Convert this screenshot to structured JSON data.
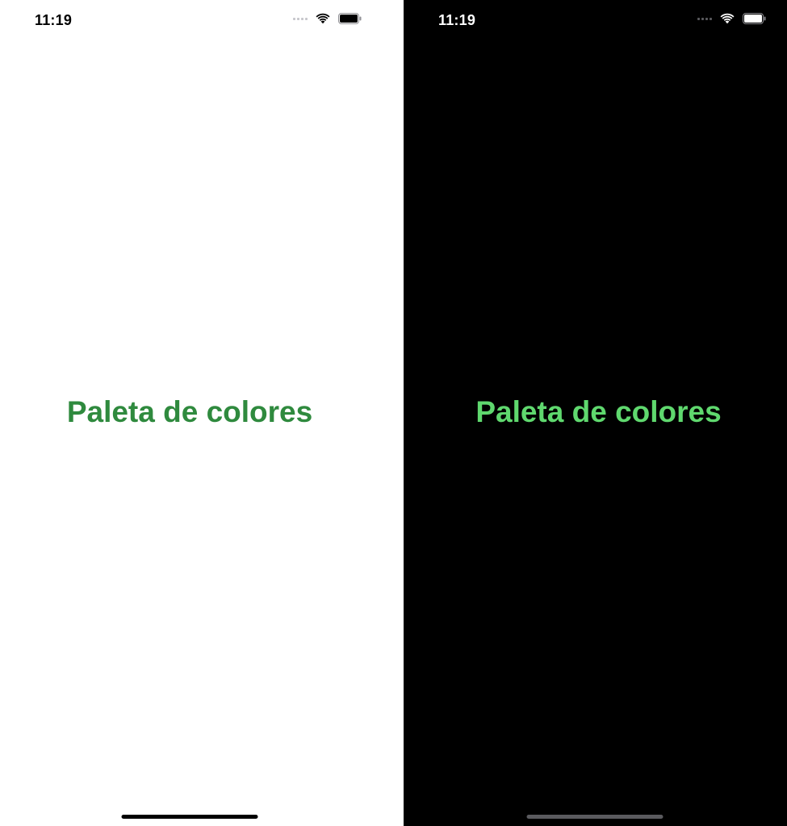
{
  "screens": [
    {
      "theme": "light",
      "time": "11:19",
      "headline": "Paleta de colores",
      "colors": {
        "background": "#ffffff",
        "headline": "#2f8a3e",
        "home_indicator": "#000000"
      },
      "icons": [
        "signal-icon",
        "wifi-icon",
        "battery-icon"
      ]
    },
    {
      "theme": "dark",
      "time": "11:19",
      "headline": "Paleta de colores",
      "colors": {
        "background": "#000000",
        "headline": "#5fd86e",
        "home_indicator": "#5a5a5e"
      },
      "icons": [
        "signal-icon",
        "wifi-icon",
        "battery-icon"
      ]
    }
  ]
}
